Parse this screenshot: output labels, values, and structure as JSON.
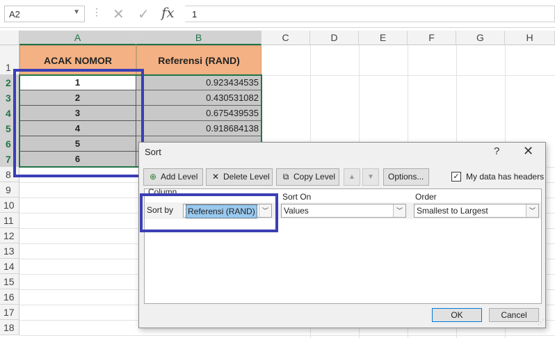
{
  "formula_bar": {
    "name_box": "A2",
    "more": "⋮",
    "cancel_icon": "✕",
    "enter_icon": "✓",
    "fx": "fx",
    "value": "1"
  },
  "columns": [
    "A",
    "B",
    "C",
    "D",
    "E",
    "F",
    "G",
    "H"
  ],
  "rows": [
    "1",
    "2",
    "3",
    "4",
    "5",
    "6",
    "7",
    "8",
    "9",
    "10",
    "11",
    "12",
    "13",
    "14",
    "15",
    "16",
    "17",
    "18"
  ],
  "sheet": {
    "header_a": "ACAK NOMOR",
    "header_b": "Referensi (RAND)",
    "numbers": [
      "1",
      "2",
      "3",
      "4",
      "5",
      "6"
    ],
    "rand_values": [
      "0.923434535",
      "0.430531082",
      "0.675439535",
      "0.918684138"
    ]
  },
  "dialog": {
    "title": "Sort",
    "help": "?",
    "close": "✕",
    "add_level": "Add Level",
    "delete_level": "Delete Level",
    "copy_level": "Copy Level",
    "move_up": "▲",
    "move_down": "▼",
    "options": "Options...",
    "headers_label": "My data has headers",
    "headers_checked": "✓",
    "col_column": "Column",
    "col_sort_on": "Sort On",
    "col_order": "Order",
    "sort_by_label": "Sort by",
    "sort_by_value": "Referensi (RAND)",
    "sort_on_value": "Values",
    "order_value": "Smallest to Largest",
    "ok": "OK",
    "cancel": "Cancel"
  },
  "colors": {
    "header_fill": "#f4b183",
    "selection_green": "#217346",
    "highlight_box": "#3b3fb5"
  }
}
